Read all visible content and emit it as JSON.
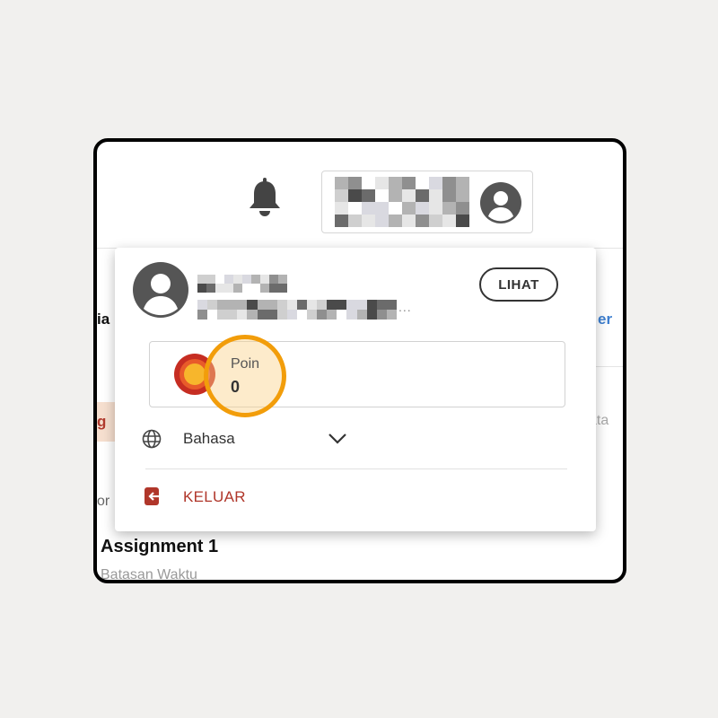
{
  "header": {
    "notifications_icon": "bell-icon",
    "profile_icon": "avatar-icon"
  },
  "background_page": {
    "left_heading_fragment": "ia",
    "right_link_fragment": "er",
    "left_tag_fragment": "g",
    "right_text_fragment": "ata",
    "left_text_fragment": "or",
    "assignment_title": "Assignment 1",
    "assignment_subtitle": "Batasan Waktu"
  },
  "menu": {
    "view_button": "LIHAT",
    "email_ellipsis": "...",
    "points": {
      "label": "Poin",
      "value": "0",
      "icon": "coin-icon",
      "highlight_color": "#f29d0a"
    },
    "language": {
      "label": "Bahasa",
      "icon": "globe-icon",
      "expand_icon": "chevron-down-icon"
    },
    "logout": {
      "label": "KELUAR",
      "icon": "logout-icon",
      "color": "#b0362a"
    }
  }
}
